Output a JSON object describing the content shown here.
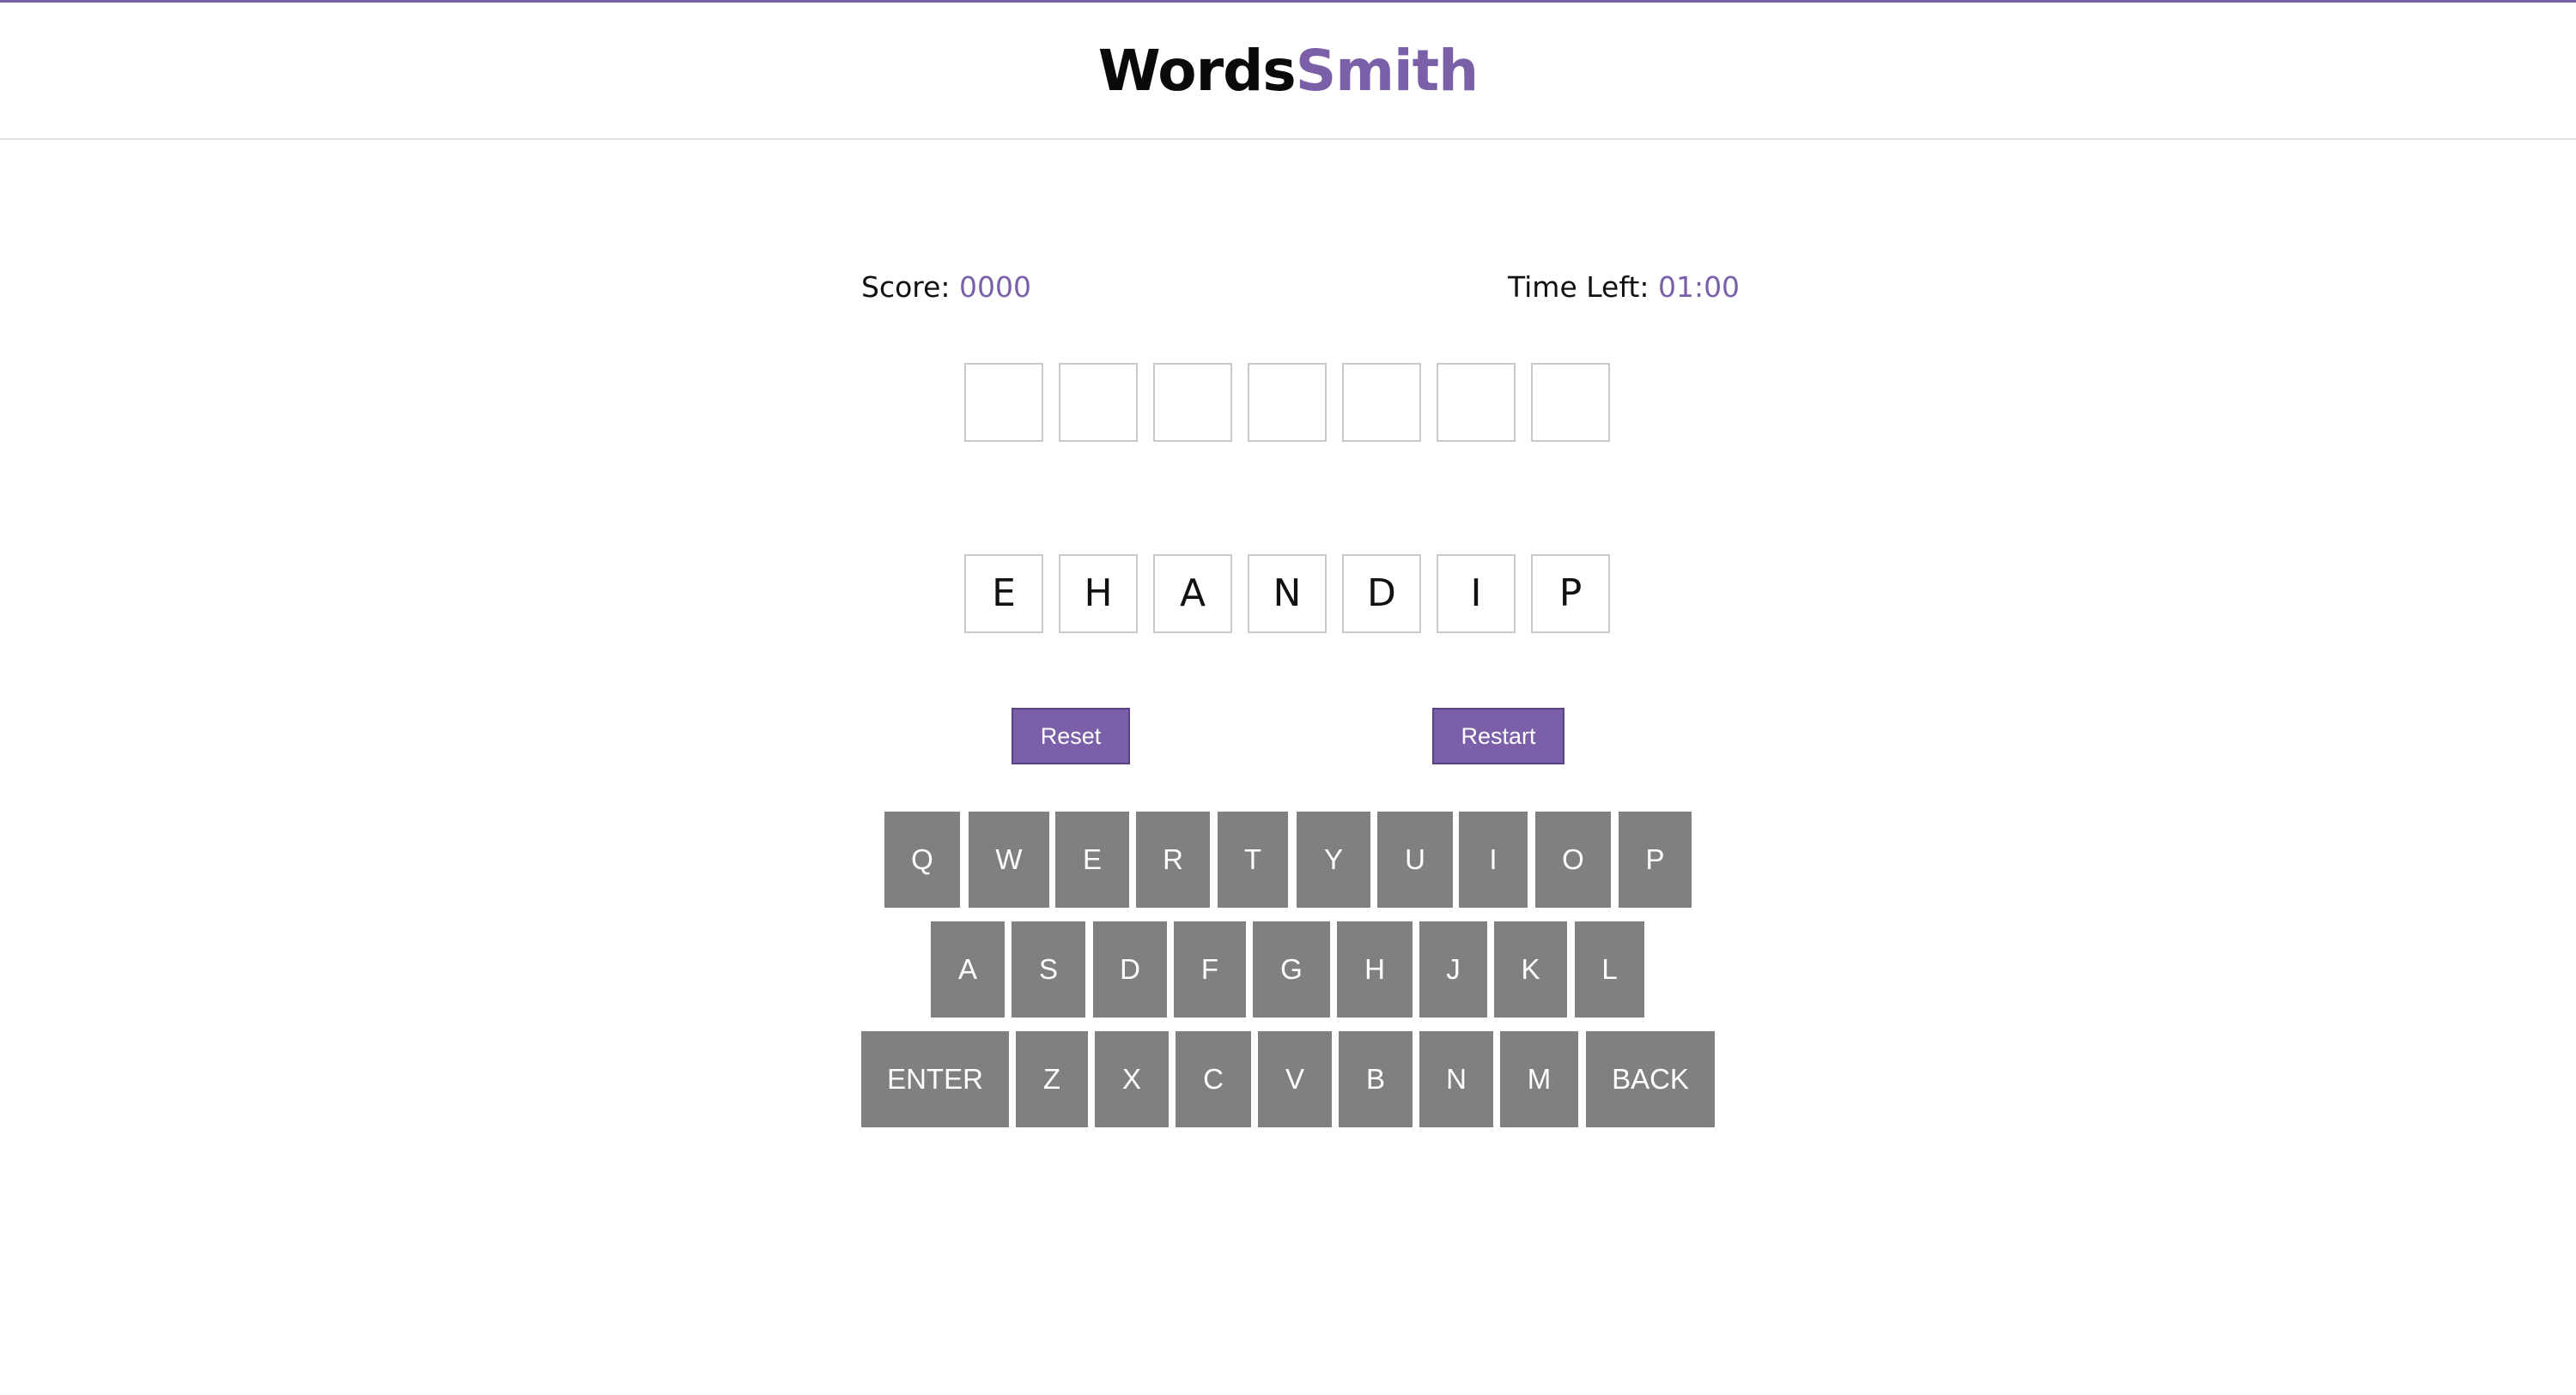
{
  "app": {
    "logo_part1": "Words",
    "logo_part2": "Smith"
  },
  "colors": {
    "accent": "#7b5fa8",
    "key_bg": "#808080",
    "tile_border": "#c9c9c9"
  },
  "stats": {
    "score_label": "Score:",
    "score_value": "0000",
    "time_label": "Time Left:",
    "time_value": "01:00"
  },
  "answer_slots": [
    "",
    "",
    "",
    "",
    "",
    "",
    ""
  ],
  "letters": [
    "E",
    "H",
    "A",
    "N",
    "D",
    "I",
    "P"
  ],
  "buttons": {
    "reset": "Reset",
    "restart": "Restart"
  },
  "keyboard": {
    "row1": [
      "Q",
      "W",
      "E",
      "R",
      "T",
      "Y",
      "U",
      "I",
      "O",
      "P"
    ],
    "row2": [
      "A",
      "S",
      "D",
      "F",
      "G",
      "H",
      "J",
      "K",
      "L"
    ],
    "row3": [
      "ENTER",
      "Z",
      "X",
      "C",
      "V",
      "B",
      "N",
      "M",
      "BACK"
    ]
  }
}
